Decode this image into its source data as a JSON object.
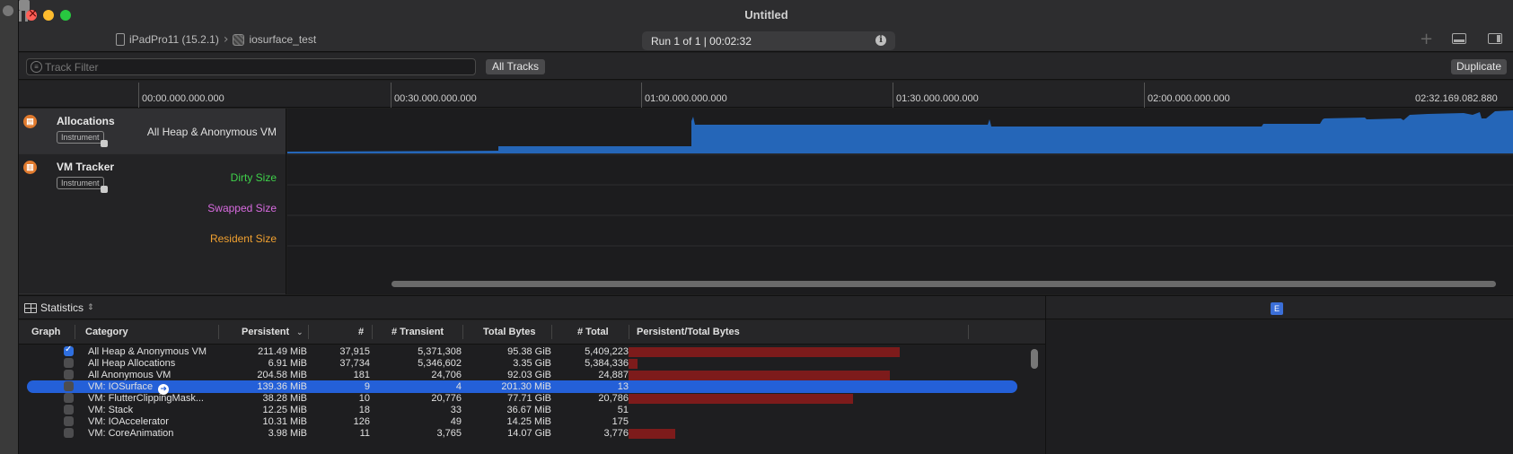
{
  "window": {
    "title": "Untitled"
  },
  "toolbar": {
    "device": "iPadPro11 (15.2.1)",
    "target": "iosurface_test",
    "run_status": "Run 1 of 1  |  00:02:32"
  },
  "filter": {
    "placeholder": "Track Filter",
    "scope": "All Tracks",
    "duplicate": "Duplicate"
  },
  "timeline": {
    "labels": [
      "00:00.000.000.000",
      "00:30.000.000.000",
      "01:00.000.000.000",
      "01:30.000.000.000",
      "02:00.000.000.000",
      "02:32.169.082.880"
    ]
  },
  "tracks": {
    "allocations": {
      "name": "Allocations",
      "badge": "Instrument",
      "title": "All Heap & Anonymous VM"
    },
    "vm_tracker": {
      "name": "VM Tracker",
      "badge": "Instrument",
      "dirty": "Dirty Size",
      "swapped": "Swapped Size",
      "resident": "Resident Size"
    }
  },
  "colors": {
    "dirty": "#3fd14a",
    "swapped": "#d86be0",
    "resident": "#f0a030",
    "series": "#2566b8",
    "selection": "#2460d8",
    "bar": "#7d1b1b"
  },
  "stats": {
    "selector": "Statistics",
    "badge": "E"
  },
  "table": {
    "headers": {
      "graph": "Graph",
      "category": "Category",
      "persistent": "Persistent",
      "count": "#",
      "transient": "# Transient",
      "total_bytes": "Total Bytes",
      "total": "# Total",
      "ratio": "Persistent/Total Bytes"
    },
    "rows": [
      {
        "checked": true,
        "category": "All Heap & Anonymous VM",
        "persistent": "211.49 MiB",
        "count": "37,915",
        "transient": "5,371,308",
        "total_bytes": "95.38 GiB",
        "total": "5,409,223",
        "ratio": 0.29
      },
      {
        "checked": false,
        "category": "All Heap Allocations",
        "persistent": "6.91 MiB",
        "count": "37,734",
        "transient": "5,346,602",
        "total_bytes": "3.35 GiB",
        "total": "5,384,336",
        "ratio": 0.01
      },
      {
        "checked": false,
        "category": "All Anonymous VM",
        "persistent": "204.58 MiB",
        "count": "181",
        "transient": "24,706",
        "total_bytes": "92.03 GiB",
        "total": "24,887",
        "ratio": 0.28
      },
      {
        "checked": false,
        "category": "VM: IOSurface",
        "persistent": "139.36 MiB",
        "count": "9",
        "transient": "4",
        "total_bytes": "201.30 MiB",
        "total": "13",
        "ratio": 0,
        "selected": true
      },
      {
        "checked": false,
        "category": "VM: FlutterClippingMask...",
        "persistent": "38.28 MiB",
        "count": "10",
        "transient": "20,776",
        "total_bytes": "77.71 GiB",
        "total": "20,786",
        "ratio": 0.24
      },
      {
        "checked": false,
        "category": "VM: Stack",
        "persistent": "12.25 MiB",
        "count": "18",
        "transient": "33",
        "total_bytes": "36.67 MiB",
        "total": "51",
        "ratio": 0
      },
      {
        "checked": false,
        "category": "VM: IOAccelerator",
        "persistent": "10.31 MiB",
        "count": "126",
        "transient": "49",
        "total_bytes": "14.25 MiB",
        "total": "175",
        "ratio": 0
      },
      {
        "checked": false,
        "category": "VM: CoreAnimation",
        "persistent": "3.98 MiB",
        "count": "11",
        "transient": "3,765",
        "total_bytes": "14.07 GiB",
        "total": "3,776",
        "ratio": 0.05
      }
    ]
  }
}
